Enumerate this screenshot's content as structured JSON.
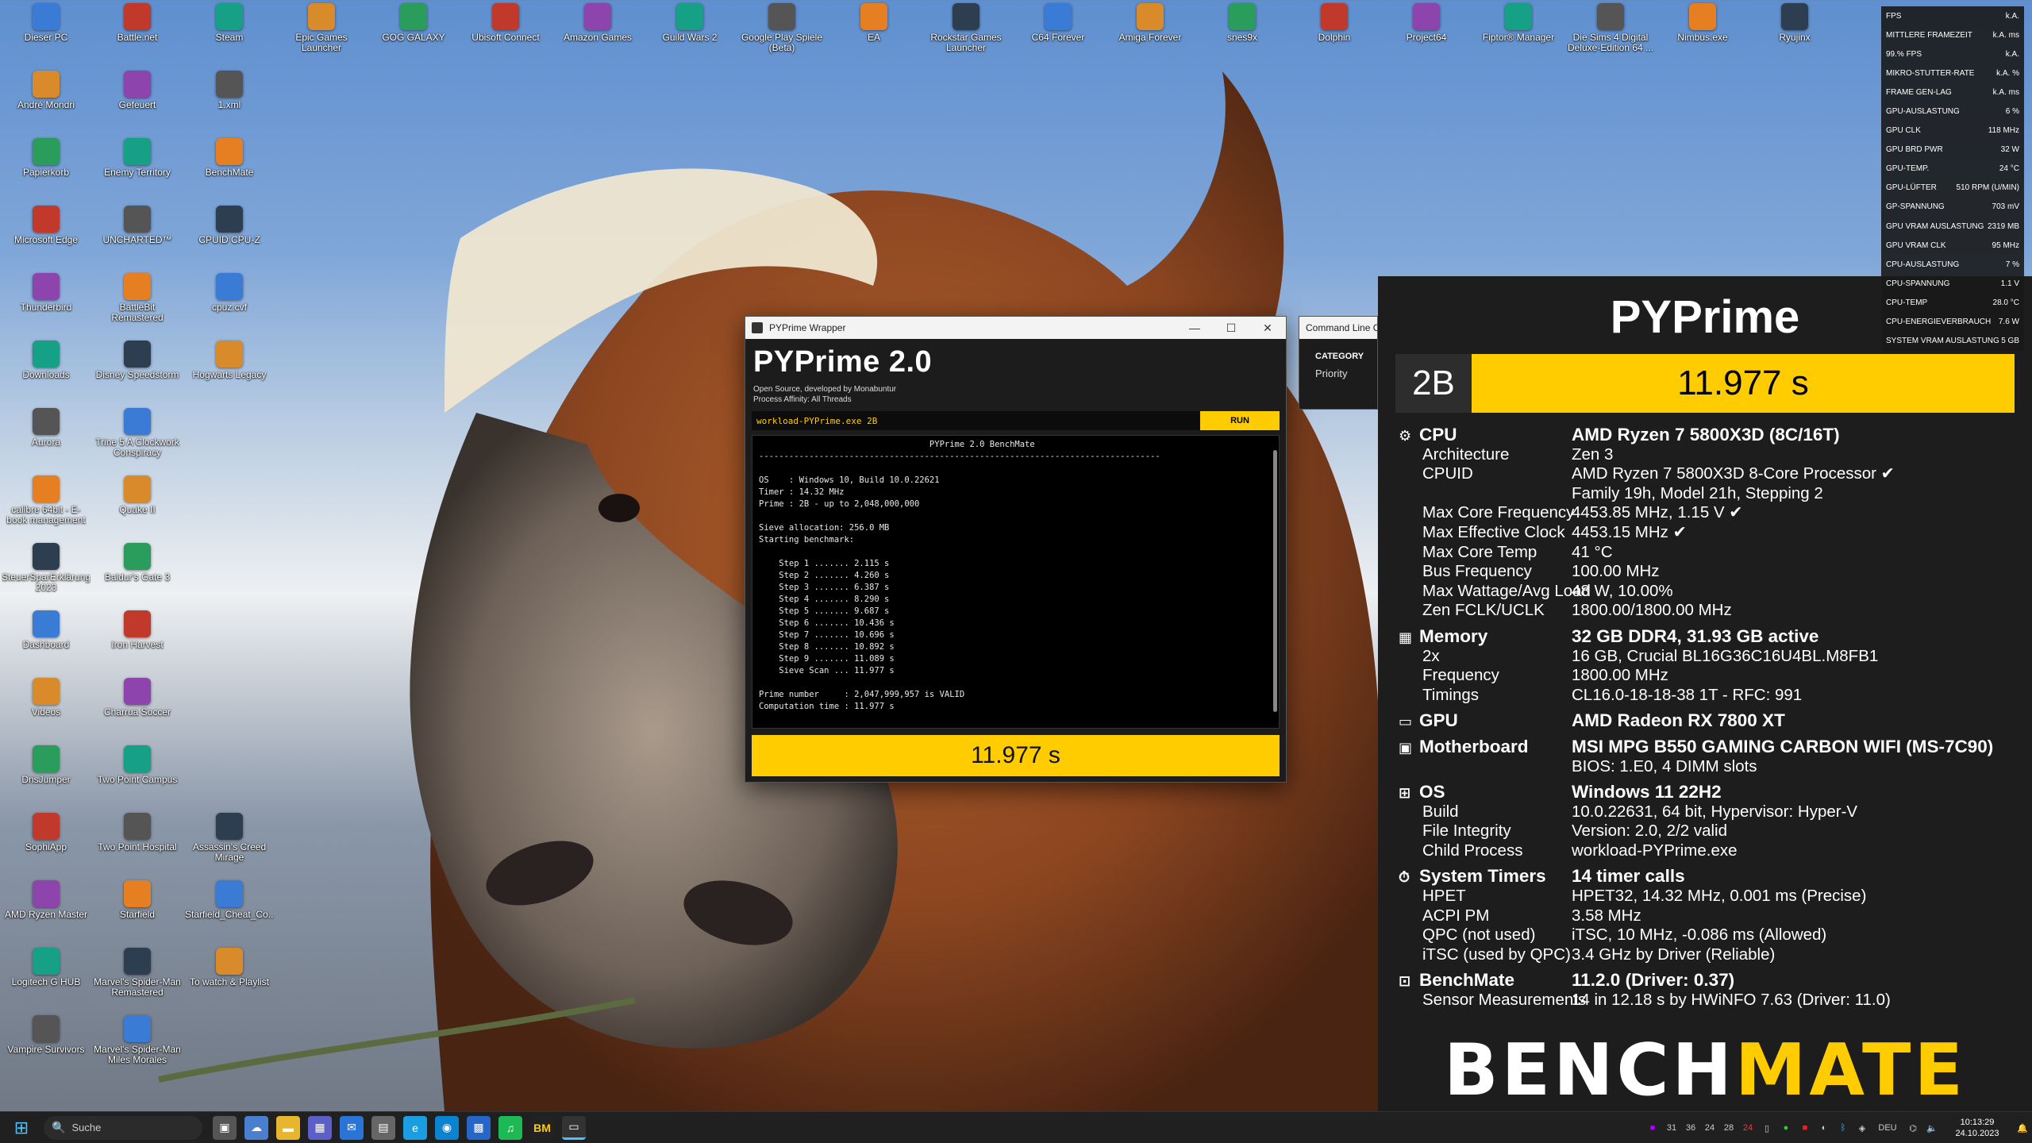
{
  "desktop": {
    "col1": [
      "Dieser PC",
      "André Mondri",
      "Papierkorb",
      "Microsoft Edge",
      "Thunderbird",
      "Downloads",
      "Aurora",
      "calibre 64bit - E-book management",
      "SteuerSparErklärung 2023",
      "Dashboard",
      "Videos",
      "DnsJumper",
      "SophiApp",
      "AMD Ryzen Master",
      "Logitech G HUB",
      "Vampire Survivors"
    ],
    "col2": [
      "Battle.net",
      "Gefeuert",
      "Enemy Territory",
      "UNCHARTED™",
      "BattleBit Remastered",
      "Disney Speedstorm",
      "Trine 5 A Clockwork Conspiracy",
      "Quake II",
      "Baldur's Gate 3",
      "Iron Harvest",
      "Charrua Soccer",
      "Two Point Campus",
      "Two Point Hospital",
      "Starfield",
      "Marvel's Spider-Man Remastered",
      "Marvel's Spider-Man Miles Morales"
    ],
    "col3": [
      "Steam",
      "1.xml",
      "BenchMate",
      "CPUID CPU-Z",
      "cpuz.cvf",
      "Hogwarts Legacy",
      "",
      "",
      "",
      "",
      "",
      "",
      "Assassin's Creed Mirage",
      "Starfield_Cheat_Co...",
      "To watch & Playlist"
    ],
    "toprow": [
      "Epic Games Launcher",
      "GOG GALAXY",
      "Ubisoft Connect",
      "Amazon Games",
      "Guild Wars 2",
      "Google Play Spiele (Beta)",
      "EA",
      "Rockstar Games Launcher",
      "C64 Forever",
      "Amiga Forever",
      "snes9x",
      "Dolphin",
      "Project64",
      "Fiptor® Manager",
      "Die Sims 4 Digital Deluxe-Edition 64 ...",
      "Nimbus.exe",
      "Ryujinx"
    ]
  },
  "wrapper": {
    "window_title": "PYPrime Wrapper",
    "heading": "PYPrime 2.0",
    "subtitle1": "Open Source, developed by Monabuntur",
    "subtitle2": "Process Affinity: All Threads",
    "command": "workload-PYPrime.exe 2B",
    "run_label": "RUN",
    "console": "                                  PYPrime 2.0 BenchMate\n--------------------------------------------------------------------------------\n\nOS    : Windows 10, Build 10.0.22621\nTimer : 14.32 MHz\nPrime : 2B - up to 2,048,000,000\n\nSieve allocation: 256.0 MB\nStarting benchmark:\n\n    Step 1 ....... 2.115 s\n    Step 2 ....... 4.260 s\n    Step 3 ....... 6.387 s\n    Step 4 ....... 8.290 s\n    Step 5 ....... 9.687 s\n    Step 6 ....... 10.436 s\n    Step 7 ....... 10.696 s\n    Step 8 ....... 10.892 s\n    Step 9 ....... 11.089 s\n    Sieve Scan ... 11.977 s\n\nPrime number     : 2,047,999,957 is VALID\nComputation time : 11.977 s",
    "result": "11.977 s"
  },
  "cmdwin": {
    "title": "Command Line O",
    "category": "CATEGORY",
    "priority": "Priority"
  },
  "benchmate": {
    "title": "PYPrime",
    "score_category": "2B",
    "score": "11.977 s",
    "rows": [
      {
        "k": "CPU",
        "v": "AMD Ryzen 7 5800X3D (8C/16T)",
        "h": true,
        "icon": "⚙"
      },
      {
        "k": "Architecture",
        "v": "Zen 3"
      },
      {
        "k": "CPUID",
        "v": "AMD Ryzen 7 5800X3D 8-Core Processor ✔"
      },
      {
        "k": "",
        "v": "Family 19h, Model 21h, Stepping 2"
      },
      {
        "k": "Max Core Frequency",
        "v": "4453.85 MHz, 1.15 V ✔"
      },
      {
        "k": "Max Effective Clock",
        "v": "4453.15 MHz ✔"
      },
      {
        "k": "Max Core Temp",
        "v": "41 °C"
      },
      {
        "k": "Bus Frequency",
        "v": "100.00 MHz"
      },
      {
        "k": "Max Wattage/Avg Load",
        "v": "48 W, 10.00%"
      },
      {
        "k": "Zen FCLK/UCLK",
        "v": "1800.00/1800.00 MHz"
      },
      {
        "k": "Memory",
        "v": "32 GB DDR4, 31.93 GB active",
        "h": true,
        "icon": "▦"
      },
      {
        "k": "2x",
        "v": "16 GB, Crucial BL16G36C16U4BL.M8FB1"
      },
      {
        "k": "Frequency",
        "v": "1800.00 MHz"
      },
      {
        "k": "Timings",
        "v": "CL16.0-18-18-38 1T - RFC: 991"
      },
      {
        "k": "GPU",
        "v": "AMD Radeon RX 7800 XT",
        "h": true,
        "icon": "▭"
      },
      {
        "k": "Motherboard",
        "v": "MSI MPG B550 GAMING CARBON WIFI (MS-7C90)",
        "h": true,
        "icon": "▣"
      },
      {
        "k": "",
        "v": "BIOS: 1.E0, 4 DIMM slots"
      },
      {
        "k": "OS",
        "v": "Windows 11 22H2",
        "h": true,
        "icon": "⊞"
      },
      {
        "k": "Build",
        "v": "10.0.22631, 64 bit, Hypervisor: Hyper-V"
      },
      {
        "k": "File Integrity",
        "v": "Version: 2.0, 2/2 valid"
      },
      {
        "k": "Child Process",
        "v": "workload-PYPrime.exe"
      },
      {
        "k": "System Timers",
        "v": "14 timer calls",
        "h": true,
        "icon": "⏱"
      },
      {
        "k": "HPET",
        "v": "HPET32, 14.32 MHz, 0.001 ms (Precise)"
      },
      {
        "k": "ACPI PM",
        "v": "3.58 MHz"
      },
      {
        "k": "QPC (not used)",
        "v": "iTSC, 10 MHz, -0.086 ms (Allowed)"
      },
      {
        "k": "iTSC (used by QPC)",
        "v": "3.4 GHz by Driver (Reliable)"
      },
      {
        "k": "BenchMate",
        "v": "11.2.0 (Driver: 0.37)",
        "h": true,
        "icon": "⊡"
      },
      {
        "k": "Sensor Measurements",
        "v": "14 in 12.18 s by HWiNFO 7.63 (Driver: 11.0)"
      }
    ],
    "logo_a": "BENCH",
    "logo_b": "MATE"
  },
  "osd": [
    [
      "FPS",
      "k.A."
    ],
    [
      "MITTLERE FRAMEZEIT",
      "k.A. ms"
    ],
    [
      "99.% FPS",
      "k.A."
    ],
    [
      "MIKRO-STUTTER-RATE",
      "k.A. %"
    ],
    [
      "FRAME GEN-LAG",
      "k.A. ms"
    ],
    [
      "GPU-AUSLASTUNG",
      "6 %"
    ],
    [
      "GPU CLK",
      "118 MHz"
    ],
    [
      "GPU BRD PWR",
      "32 W"
    ],
    [
      "GPU-TEMP.",
      "24 °C"
    ],
    [
      "GPU-LÜFTER",
      "510 RPM (U/MIN)"
    ],
    [
      "GP-SPANNUNG",
      "703 mV"
    ],
    [
      "GPU VRAM AUSLASTUNG",
      "2319 MB"
    ],
    [
      "GPU VRAM CLK",
      "95 MHz"
    ],
    [
      "CPU-AUSLASTUNG",
      "7 %"
    ],
    [
      "CPU-SPANNUNG",
      "1.1 V"
    ],
    [
      "CPU-TEMP",
      "28.0 °C"
    ],
    [
      "CPU-ENERGIEVERBRAUCH",
      "7.6 W"
    ],
    [
      "SYSTEM VRAM AUSLASTUNG",
      "5 GB"
    ]
  ],
  "taskbar": {
    "search_placeholder": "Suche",
    "tray_numbers": [
      "31",
      "36",
      "24",
      "28",
      "24"
    ],
    "lang": "DEU",
    "time": "10:13:29",
    "date": "24.10.2023"
  }
}
